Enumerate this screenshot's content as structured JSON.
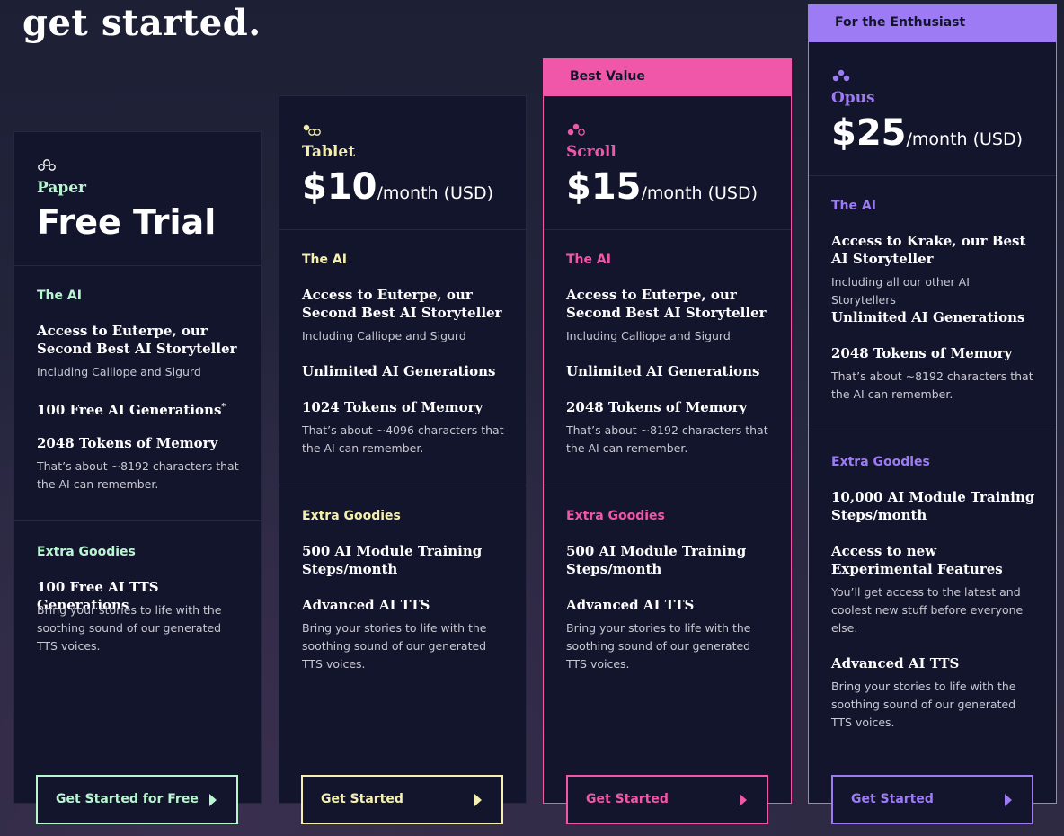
{
  "headline": "get started.",
  "tiers": [
    {
      "name": "Paper",
      "price_text": "Free Trial",
      "accent": "#b8f5d0",
      "section_ai": "The AI",
      "ai_features": [
        {
          "title": "Access to Euterpe, our Second Best AI Storyteller",
          "desc": "Including Calliope and Sigurd"
        },
        {
          "title": "100 Free AI Generations",
          "sup": "*",
          "desc": ""
        },
        {
          "title": "2048 Tokens of Memory",
          "desc": "That’s about ~8192 characters that the AI can remember."
        }
      ],
      "section_extra": "Extra Goodies",
      "extra_features": [
        {
          "title": "100 Free AI TTS Generations",
          "desc": "Bring your stories to life with the soothing sound of our generated TTS voices."
        }
      ],
      "cta": "Get Started for Free",
      "icon": "paper-tier-icon"
    },
    {
      "name": "Tablet",
      "price": "$10",
      "per": "/month (USD)",
      "accent": "#f5f0b0",
      "section_ai": "The AI",
      "ai_features": [
        {
          "title": "Access to Euterpe, our Second Best AI Storyteller",
          "desc": "Including Calliope and Sigurd"
        },
        {
          "title": "Unlimited AI Generations",
          "desc": ""
        },
        {
          "title": "1024 Tokens of Memory",
          "desc": "That’s about ~4096 characters that the AI can remember."
        }
      ],
      "section_extra": "Extra Goodies",
      "extra_features": [
        {
          "title": "500 AI Module Training Steps/month",
          "desc": ""
        },
        {
          "title": "Advanced AI TTS",
          "desc": "Bring your stories to life with the soothing sound of our generated TTS voices."
        }
      ],
      "cta": "Get Started",
      "icon": "tablet-tier-icon"
    },
    {
      "banner": "Best Value",
      "name": "Scroll",
      "price": "$15",
      "per": "/month (USD)",
      "accent": "#f057a8",
      "section_ai": "The AI",
      "ai_features": [
        {
          "title": "Access to Euterpe, our Second Best AI Storyteller",
          "desc": "Including Calliope and Sigurd"
        },
        {
          "title": "Unlimited AI Generations",
          "desc": ""
        },
        {
          "title": "2048 Tokens of Memory",
          "desc": "That’s about ~8192 characters that the AI can remember."
        }
      ],
      "section_extra": "Extra Goodies",
      "extra_features": [
        {
          "title": "500 AI Module Training Steps/month",
          "desc": ""
        },
        {
          "title": "Advanced AI TTS",
          "desc": "Bring your stories to life with the soothing sound of our generated TTS voices."
        }
      ],
      "cta": "Get Started",
      "icon": "scroll-tier-icon"
    },
    {
      "banner": "For the Enthusiast",
      "name": "Opus",
      "price": "$25",
      "per": "/month (USD)",
      "accent": "#9d7bf5",
      "section_ai": "The AI",
      "ai_features": [
        {
          "title": "Access to Krake, our Best AI Storyteller",
          "desc": "Including all our other AI Storytellers"
        },
        {
          "title": "Unlimited AI Generations",
          "desc": ""
        },
        {
          "title": "2048 Tokens of Memory",
          "desc": "That’s about ~8192 characters that the AI can remember."
        }
      ],
      "section_extra": "Extra Goodies",
      "extra_features": [
        {
          "title": "10,000 AI Module Training Steps/month",
          "desc": ""
        },
        {
          "title": "Access to new Experimental Features",
          "desc": "You’ll get access to the latest and coolest new stuff before everyone else."
        },
        {
          "title": "Advanced AI TTS",
          "desc": "Bring your stories to life with the soothing sound of our generated TTS voices."
        }
      ],
      "cta": "Get Started",
      "icon": "opus-tier-icon"
    }
  ]
}
